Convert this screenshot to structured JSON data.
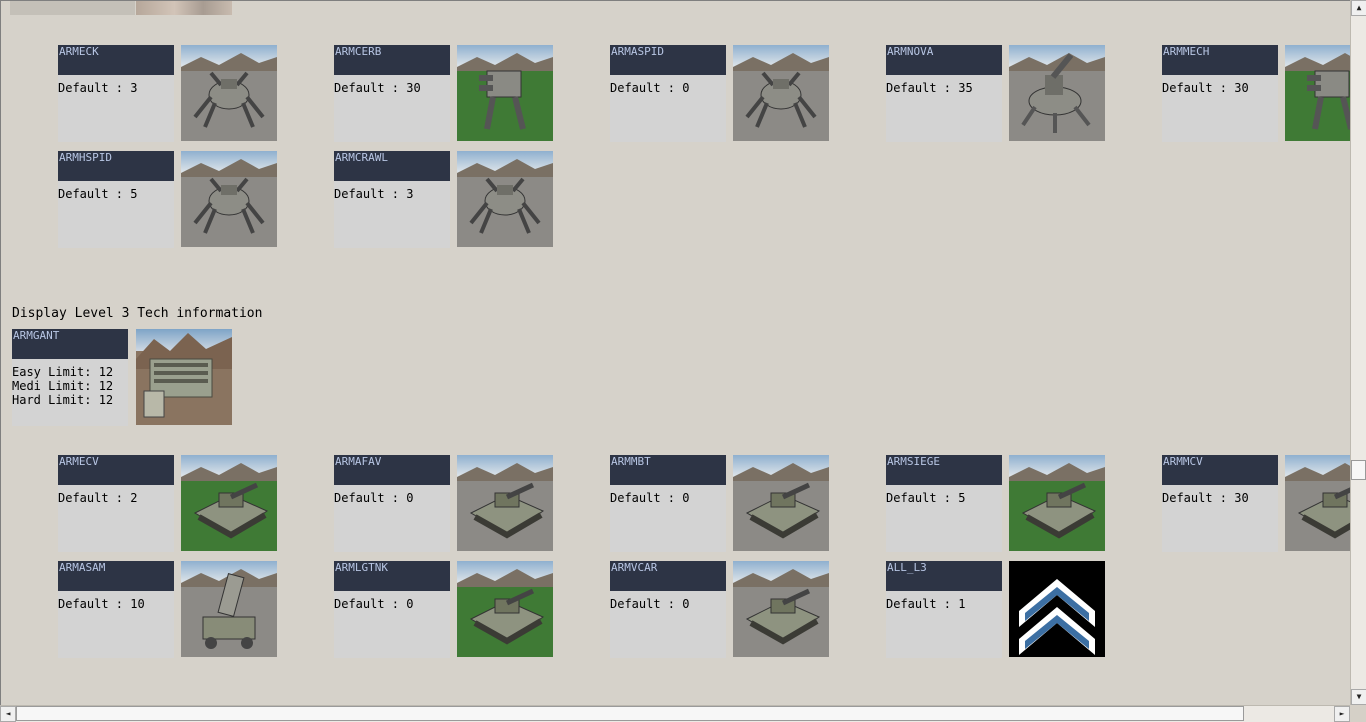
{
  "level2": {
    "units": [
      {
        "name": "ARMECK",
        "default": "Default : 3",
        "icon": "spider-unit-image"
      },
      {
        "name": "ARMCERB",
        "default": "Default : 30",
        "icon": "walker-unit-image"
      },
      {
        "name": "ARMASPID",
        "default": "Default : 0",
        "icon": "spider-unit-image"
      },
      {
        "name": "ARMNOVA",
        "default": "Default : 35",
        "icon": "artillery-unit-image"
      },
      {
        "name": "ARMMECH",
        "default": "Default : 30",
        "icon": "walker-unit-image"
      },
      {
        "name": "ARMHSPID",
        "default": "Default : 5",
        "icon": "spider-unit-image"
      },
      {
        "name": "ARMCRAWL",
        "default": "Default : 3",
        "icon": "crawler-unit-image"
      }
    ]
  },
  "level3": {
    "title": "Display Level 3 Tech information",
    "factory": {
      "name": "ARMGANT",
      "easy": "Easy Limit: 12",
      "medi": "Medi Limit: 12",
      "hard": "Hard Limit: 12",
      "icon": "factory-building-image"
    },
    "units": [
      {
        "name": "ARMECV",
        "default": "Default : 2",
        "icon": "vehicle-unit-image"
      },
      {
        "name": "ARMAFAV",
        "default": "Default : 0",
        "icon": "vehicle-unit-image"
      },
      {
        "name": "ARMMBT",
        "default": "Default : 0",
        "icon": "tank-unit-image"
      },
      {
        "name": "ARMSIEGE",
        "default": "Default : 5",
        "icon": "tank-unit-image"
      },
      {
        "name": "ARMMCV",
        "default": "Default : 30",
        "icon": "vehicle-unit-image"
      },
      {
        "name": "ARMASAM",
        "default": "Default : 10",
        "icon": "missile-unit-image"
      },
      {
        "name": "ARMLGTNK",
        "default": "Default : 0",
        "icon": "tank-unit-image"
      },
      {
        "name": "ARMVCAR",
        "default": "Default : 0",
        "icon": "vehicle-unit-image"
      },
      {
        "name": "ALL_L3",
        "default": "Default : 1",
        "icon": "chevron-rank-icon"
      }
    ]
  },
  "scrollbar": {
    "up": "▲",
    "down": "▼",
    "left": "◄",
    "right": "►"
  },
  "colors": {
    "header": "#2d3445",
    "header_text": "#b8c6e4",
    "card": "#d3d3d3",
    "page": "#d6d2ca"
  }
}
